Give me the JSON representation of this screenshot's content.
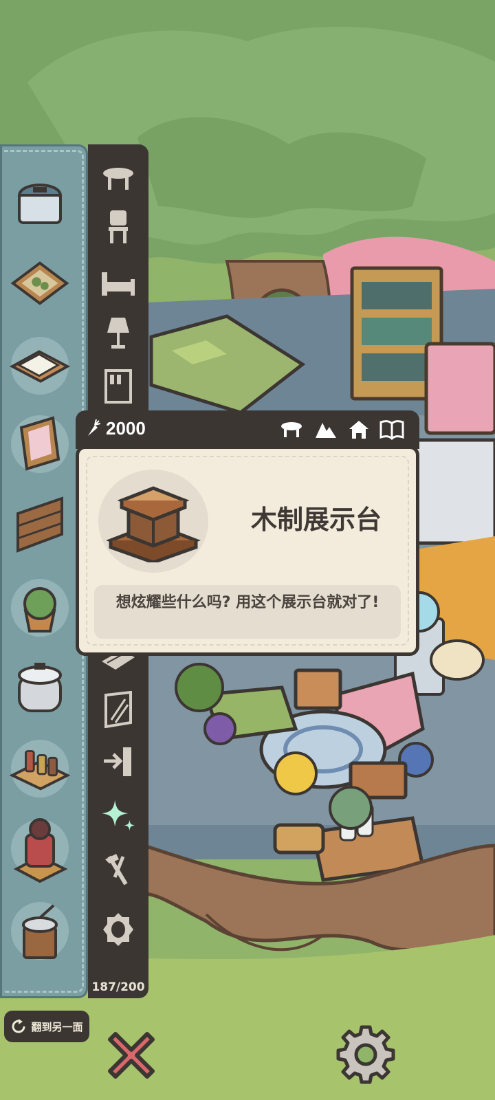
{
  "currency": {
    "amount": "2000",
    "icon": "carrot-icon"
  },
  "item": {
    "name": "木制展示台",
    "description": "想炫耀些什么吗? 用这个展示台就对了!"
  },
  "capacity": "187/200",
  "flip_button": {
    "label": "翻到另一面",
    "icon": "rotate-icon"
  },
  "card_header_icons": [
    "table-icon",
    "mountain-icon",
    "house-icon",
    "book-icon"
  ],
  "categories": [
    "table-icon",
    "chair-icon",
    "bed-icon",
    "lamp-icon",
    "shelf-icon",
    "rug-icon",
    "wallpaper-icon",
    "door-icon",
    "sparkle-icon",
    "tools-icon",
    "seal-icon"
  ],
  "selected_category": "sparkle-icon",
  "items": [
    "trash-bin",
    "plant-tray",
    "notebook",
    "picture-frame",
    "wooden-fence",
    "potted-cabbage",
    "rice-cooker",
    "spice-shelf",
    "samurai-armor",
    "coffee-grinder"
  ],
  "colors": {
    "panel": "#3c3633",
    "item_strip": "#7b9ea3",
    "card": "#f3ecdc",
    "accent_selected": "#b7f1d4",
    "close": "#d9686a"
  }
}
